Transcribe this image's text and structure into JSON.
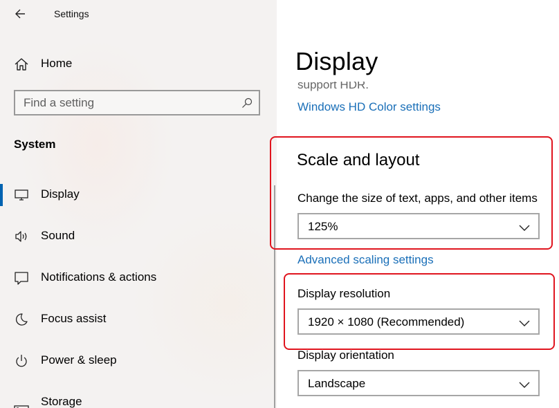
{
  "window": {
    "title": "Settings"
  },
  "sidebar": {
    "home_label": "Home",
    "search": {
      "placeholder": "Find a setting",
      "value": ""
    },
    "section_title": "System",
    "items": [
      {
        "label": "Display",
        "icon": "monitor-icon",
        "active": true
      },
      {
        "label": "Sound",
        "icon": "speaker-icon",
        "active": false
      },
      {
        "label": "Notifications & actions",
        "icon": "notification-icon",
        "active": false
      },
      {
        "label": "Focus assist",
        "icon": "moon-icon",
        "active": false
      },
      {
        "label": "Power & sleep",
        "icon": "power-icon",
        "active": false
      },
      {
        "label": "Storage",
        "icon": "storage-icon",
        "active": false
      }
    ]
  },
  "main": {
    "page_title": "Display",
    "hdr_trailing_text": "support HDR.",
    "hdr_link": "Windows HD Color settings",
    "scale_section": {
      "heading": "Scale and layout",
      "size_label": "Change the size of text, apps, and other items",
      "size_value": "125%",
      "advanced_link": "Advanced scaling settings"
    },
    "resolution": {
      "label": "Display resolution",
      "value": "1920 × 1080 (Recommended)"
    },
    "orientation": {
      "label": "Display orientation",
      "value": "Landscape"
    }
  },
  "colors": {
    "accent": "#0063b1",
    "link": "#1a6fb8",
    "highlight": "#e0141e"
  }
}
